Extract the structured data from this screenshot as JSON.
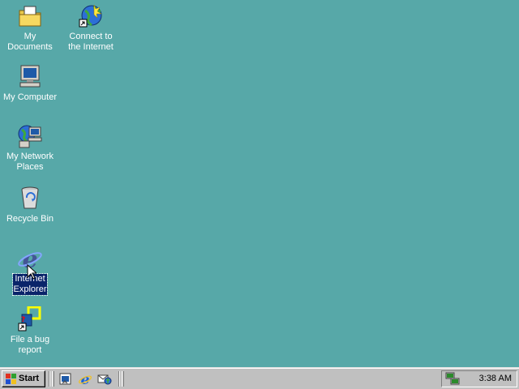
{
  "desktop": {
    "background": "#57a8a8",
    "icons": [
      {
        "id": "my-documents",
        "label": "My Documents",
        "icon": "folder-documents-icon"
      },
      {
        "id": "connect-internet",
        "label": "Connect to\nthe Internet",
        "icon": "connect-internet-icon"
      },
      {
        "id": "my-computer",
        "label": "My Computer",
        "icon": "computer-icon"
      },
      {
        "id": "my-network-places",
        "label": "My Network\nPlaces",
        "icon": "network-places-icon"
      },
      {
        "id": "recycle-bin",
        "label": "Recycle Bin",
        "icon": "recycle-bin-icon"
      },
      {
        "id": "internet-explorer",
        "label": "Internet\nExplorer",
        "icon": "internet-explorer-icon",
        "selected": true
      },
      {
        "id": "file-bug-report",
        "label": "File a bug\nreport",
        "icon": "bug-report-shortcut-icon"
      }
    ]
  },
  "taskbar": {
    "start_label": "Start",
    "quick_launch": [
      "show-desktop-icon",
      "internet-explorer-icon",
      "outlook-express-icon"
    ],
    "clock": "3:38 AM",
    "tray_icons": [
      "network-connection-icon"
    ]
  }
}
